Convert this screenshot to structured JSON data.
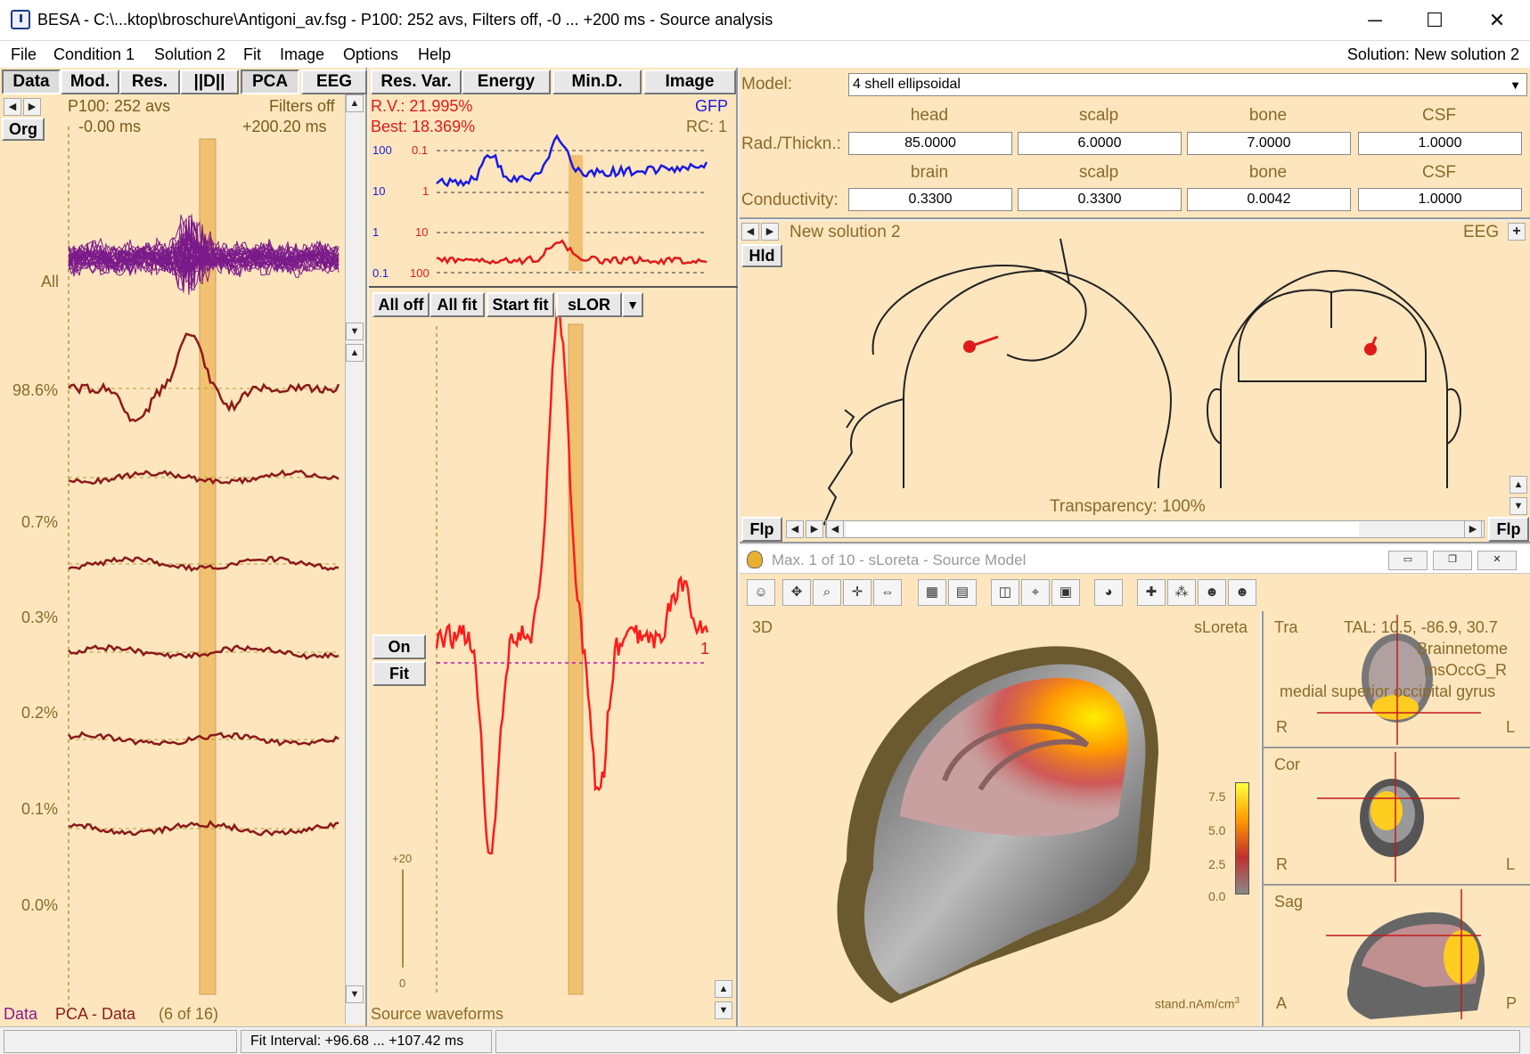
{
  "window": {
    "title": "BESA - C:\\...ktop\\broschure\\Antigoni_av.fsg - P100: 252 avs, Filters off,  -0 ... +200 ms - Source analysis",
    "controls": [
      "─",
      "☐",
      "✕"
    ]
  },
  "menu": {
    "items": [
      "File",
      "Condition 1",
      "Solution 2",
      "Fit",
      "Image",
      "Options",
      "Help"
    ],
    "solution_label": "Solution: New solution 2"
  },
  "left_panel": {
    "tabs": [
      "Data",
      "Mod.",
      "Res.",
      "||D||",
      "PCA",
      "EEG"
    ],
    "org_button": "Org",
    "condition": "P100: 252 avs",
    "filters": "Filters off",
    "time_start": "-0.00 ms",
    "time_end": "+200.20 ms",
    "all_label": "All",
    "channel_labels": [
      "98.6%",
      "0.7%",
      "0.3%",
      "0.2%",
      "0.1%",
      "0.0%"
    ],
    "footer": {
      "data": "Data",
      "pca": "PCA - Data",
      "count": "(6 of 16)"
    },
    "colors": {
      "butterfly": "#7a1a8a",
      "pca": "#8b1a1a",
      "cursor": "#f2c071"
    }
  },
  "middle_panel": {
    "tabs": [
      "Res. Var.",
      "Energy",
      "Min.D.",
      "Image"
    ],
    "rv": "R.V.: 21.995%",
    "best": "Best: 18.369%",
    "gfp": "GFP",
    "rc": "RC: 1",
    "gfp_scale": [
      "100",
      "10",
      "1",
      "0.1"
    ],
    "rv_scale": [
      "0.1",
      "1",
      "10",
      "100"
    ],
    "buttons": [
      "All off",
      "All fit",
      "Start fit",
      "sLOR",
      "▼"
    ],
    "on_button": "On",
    "fit_button": "Fit",
    "source_number": "1",
    "amp_top": "+20",
    "amp_bottom": "0",
    "footer": "Source waveforms",
    "colors": {
      "gfp": "#1a1ae0",
      "rv": "#e01a1a",
      "waveform": "#ff1a1a"
    }
  },
  "model": {
    "label": "Model:",
    "select_value": "4 shell ellipsoidal",
    "rad_label": "Rad./Thickn.:",
    "rad_headers": [
      "head",
      "scalp",
      "bone",
      "CSF"
    ],
    "rad_values": [
      "85.0000",
      "6.0000",
      "7.0000",
      "1.0000"
    ],
    "cond_label": "Conductivity:",
    "cond_headers": [
      "brain",
      "scalp",
      "bone",
      "CSF"
    ],
    "cond_values": [
      "0.3300",
      "0.3300",
      "0.0042",
      "1.0000"
    ]
  },
  "head_view": {
    "solution_name": "New solution 2",
    "eeg": "EEG",
    "plus": "+",
    "hld": "Hld",
    "transparency": "Transparency: 100%",
    "flp_left": "Flp",
    "flp_right": "Flp"
  },
  "source_model_window": {
    "title": "Max. 1 of 10 - sLoreta - Source Model",
    "view_3d": "3D",
    "method": "sLoreta",
    "colorbar_ticks": [
      "7.5",
      "5.0",
      "2.5",
      "0.0"
    ],
    "colorbar_unit": "stand.nAm/cm",
    "unit_superscript": "3",
    "tra": {
      "label": "Tra",
      "tal": "TAL: 10.5, -86.9, 30.7",
      "atlas": "Brainnetome",
      "region_code": "msOccG_R",
      "region_name": "medial superior occipital gyrus",
      "left": "R",
      "right": "L"
    },
    "cor": {
      "label": "Cor",
      "left": "R",
      "right": "L"
    },
    "sag": {
      "label": "Sag",
      "left": "A",
      "right": "P"
    }
  },
  "status": {
    "fit_interval": "Fit Interval: +96.68 ... +107.42 ms"
  }
}
